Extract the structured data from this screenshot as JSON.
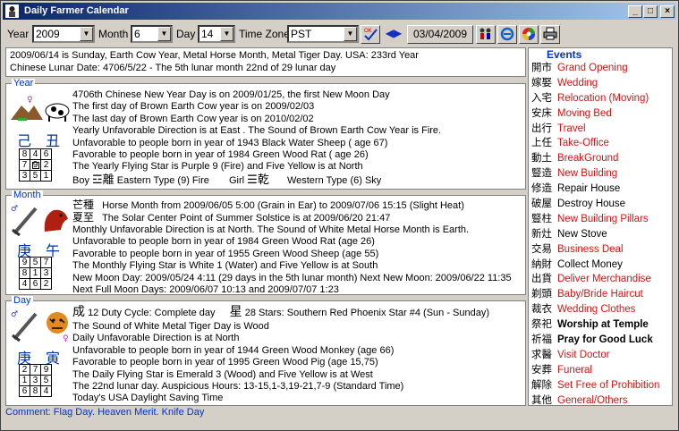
{
  "window": {
    "title": "Daily Farmer Calendar"
  },
  "toolbar": {
    "year_label": "Year",
    "year_value": "2009",
    "month_label": "Month",
    "month_value": "6",
    "day_label": "Day",
    "day_value": "14",
    "tz_label": "Time Zone",
    "tz_value": "PST",
    "date_button": "03/04/2009"
  },
  "info": {
    "line1": "2009/06/14 is Sunday,   Earth Cow Year, Metal Horse Month, Metal Tiger Day.   USA: 233rd Year",
    "line2": "Chinese Lunar Date: 4706/5/22 - The 5th lunar month 22nd of 29 lunar day"
  },
  "year": {
    "legend": "Year",
    "stem": "己",
    "branch": "丑",
    "grid": [
      "8",
      "4",
      "6",
      "7",
      "9",
      "2",
      "3",
      "5",
      "1"
    ],
    "lines": [
      "4706th Chinese New Year Day is on 2009/01/25, the first New Moon Day",
      "The first day of Brown Earth Cow year is on 2009/02/03",
      "The last day of Brown Earth Cow year is on 2010/02/02",
      "Yearly Unfavorable Direction is at East .    The Sound of Brown Earth Cow Year is Fire.",
      "Unfavorable to people born in year of 1943 Black Water Sheep ( age 67)",
      "Favorable to people born in year of 1984 Green Wood Rat ( age 26)",
      "The Yearly Flying Star is Purple 9 (Fire) and Five Yellow is at North"
    ],
    "boy_label": "Boy",
    "boy_trigram": "☲離",
    "boy_type": "Eastern Type (9) Fire",
    "girl_label": "Girl",
    "girl_trigram": "☰乾",
    "girl_type": "Western Type (6) Sky"
  },
  "month": {
    "legend": "Month",
    "stem": "庚",
    "branch": "午",
    "grid": [
      "9",
      "5",
      "7",
      "8",
      "1",
      "3",
      "4",
      "6",
      "2"
    ],
    "term1_cn": "芒種",
    "term1": "Horse Month from 2009/06/05 5:00 (Grain in Ear) to 2009/07/06 15:15 (Slight Heat)",
    "term2_cn": "夏至",
    "term2": "The Solar Center Point of Summer Solstice is at 2009/06/20 21:47",
    "lines": [
      "Monthly Unfavorable Direction is at North.      The Sound of White Metal Horse Month is Earth.",
      "Unfavorable to people born in year of 1984 Green Wood Rat (age 26)",
      "Favorable to people born in year of 1955 Green Wood Sheep (age 55)",
      "The Monthly Flying Star is White 1 (Water) and Five Yellow is at South",
      "New Moon Day: 2009/05/24 4:11 (29 days in the 5th lunar month) Next New Moon: 2009/06/22 11:35",
      "Next Full Moon Days: 2009/06/07 10:13 and 2009/07/07 1:23"
    ]
  },
  "day": {
    "legend": "Day",
    "stem": "庚",
    "branch": "寅",
    "grid": [
      "2",
      "7",
      "9",
      "1",
      "3",
      "5",
      "6",
      "8",
      "4"
    ],
    "duty_cn": "成",
    "duty": "12 Duty Cycle: Complete day",
    "star_cn": "星",
    "star": "28 Stars: Southern Red Phoenix Star #4 (Sun -  Sunday)",
    "lines": [
      "The Sound of White Metal Tiger Day is Wood",
      "Daily Unfavorable Direction is at North",
      "Unfavorable to people born in year of 1944 Green Wood Monkey (age 66)",
      "Favorable to people born in year of 1995 Green Wood Pig (age 15,75)",
      "The Daily Flying Star is Emerald 3 (Wood) and Five Yellow is at West",
      "The 22nd lunar day. Auspicious Hours: 13-15,1-3,19-21,7-9 (Standard Time)",
      "Today's USA Daylight Saving Time"
    ]
  },
  "comment": "Comment: Flag Day. Heaven Merit. Knife Day",
  "events": {
    "legend": "Events",
    "items": [
      {
        "cn": "開市",
        "en": "Grand Opening",
        "style": "red"
      },
      {
        "cn": "嫁娶",
        "en": "Wedding",
        "style": "red"
      },
      {
        "cn": "入宅",
        "en": "Relocation (Moving)",
        "style": "red"
      },
      {
        "cn": "安床",
        "en": "Moving Bed",
        "style": "red"
      },
      {
        "cn": "出行",
        "en": "Travel",
        "style": "red"
      },
      {
        "cn": "上任",
        "en": "Take-Office",
        "style": "red"
      },
      {
        "cn": "動土",
        "en": "BreakGround",
        "style": "red"
      },
      {
        "cn": "豎造",
        "en": "New Building",
        "style": "red"
      },
      {
        "cn": "修造",
        "en": "Repair House",
        "style": "blk"
      },
      {
        "cn": "破屋",
        "en": "Destroy House",
        "style": "blk"
      },
      {
        "cn": "豎柱",
        "en": "New Building Pillars",
        "style": "red"
      },
      {
        "cn": "新灶",
        "en": "New Stove",
        "style": "blk"
      },
      {
        "cn": "交易",
        "en": "Business Deal",
        "style": "red"
      },
      {
        "cn": "納財",
        "en": "Collect Money",
        "style": "blk"
      },
      {
        "cn": "出貨",
        "en": "Deliver Merchandise",
        "style": "red"
      },
      {
        "cn": "剃頭",
        "en": "Baby/Bride Haircut",
        "style": "red"
      },
      {
        "cn": "裁衣",
        "en": "Wedding Clothes",
        "style": "red"
      },
      {
        "cn": "祭祀",
        "en": "Worship at Temple",
        "style": "bold"
      },
      {
        "cn": "祈福",
        "en": "Pray for Good Luck",
        "style": "bold"
      },
      {
        "cn": "求醫",
        "en": "Visit Doctor",
        "style": "red"
      },
      {
        "cn": "安葬",
        "en": "Funeral",
        "style": "red"
      },
      {
        "cn": "解除",
        "en": "Set Free of Prohibition",
        "style": "red"
      },
      {
        "cn": "其他",
        "en": "General/Others",
        "style": "red"
      }
    ]
  },
  "colors": {
    "title_start": "#0a246a",
    "title_end": "#a6caf0",
    "accent_blue": "#0033cc",
    "event_red": "#e01010"
  }
}
